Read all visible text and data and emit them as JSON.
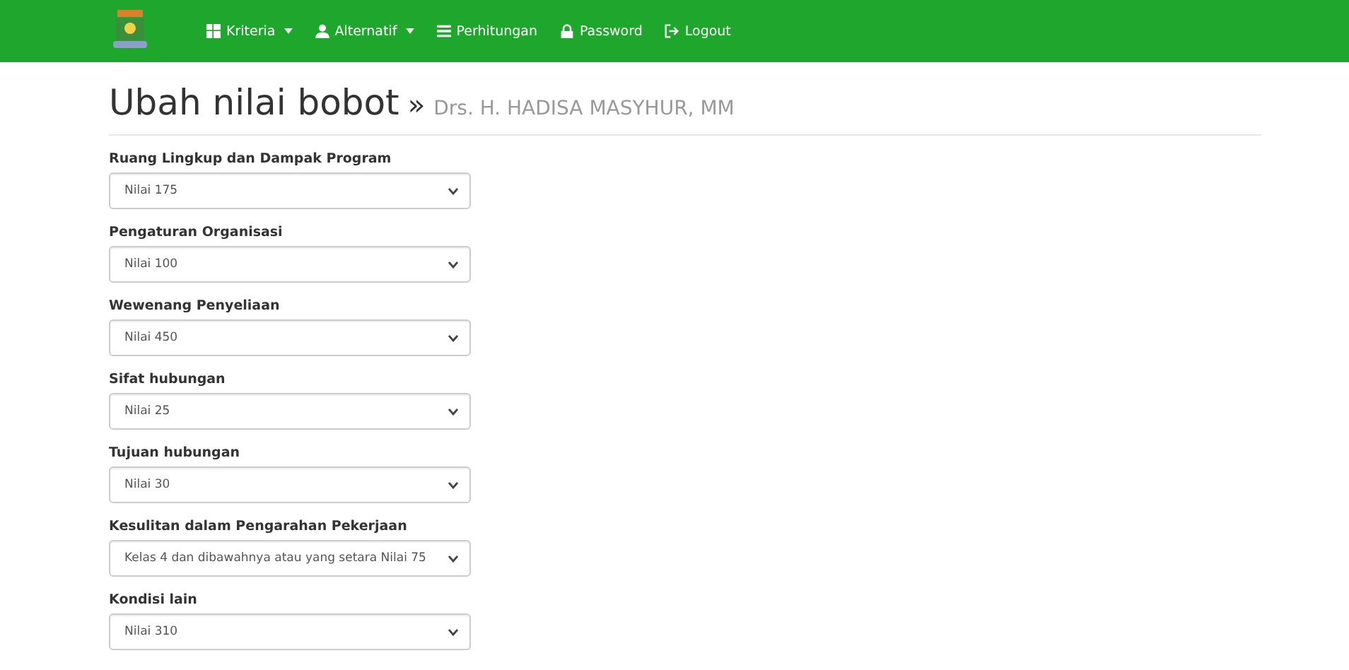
{
  "navbar": {
    "items": [
      {
        "label": "Kriteria",
        "kind": "dropdown"
      },
      {
        "label": "Alternatif",
        "kind": "dropdown"
      },
      {
        "label": "Perhitungan",
        "kind": "link"
      },
      {
        "label": "Password",
        "kind": "link"
      },
      {
        "label": "Logout",
        "kind": "link"
      }
    ]
  },
  "page": {
    "title": "Ubah nilai bobot",
    "separator": "»",
    "subtitle": "Drs. H. HADISA MASYHUR, MM"
  },
  "fields": [
    {
      "label": "Ruang Lingkup dan Dampak Program",
      "value": "Nilai 175"
    },
    {
      "label": "Pengaturan Organisasi",
      "value": "Nilai 100"
    },
    {
      "label": "Wewenang Penyeliaan",
      "value": "Nilai 450"
    },
    {
      "label": "Sifat hubungan",
      "value": "Nilai 25"
    },
    {
      "label": "Tujuan hubungan",
      "value": "Nilai 30"
    },
    {
      "label": "Kesulitan dalam Pengarahan Pekerjaan",
      "value": "Kelas 4 dan dibawahnya atau yang setara Nilai 75"
    },
    {
      "label": "Kondisi lain",
      "value": "Nilai 310"
    }
  ]
}
